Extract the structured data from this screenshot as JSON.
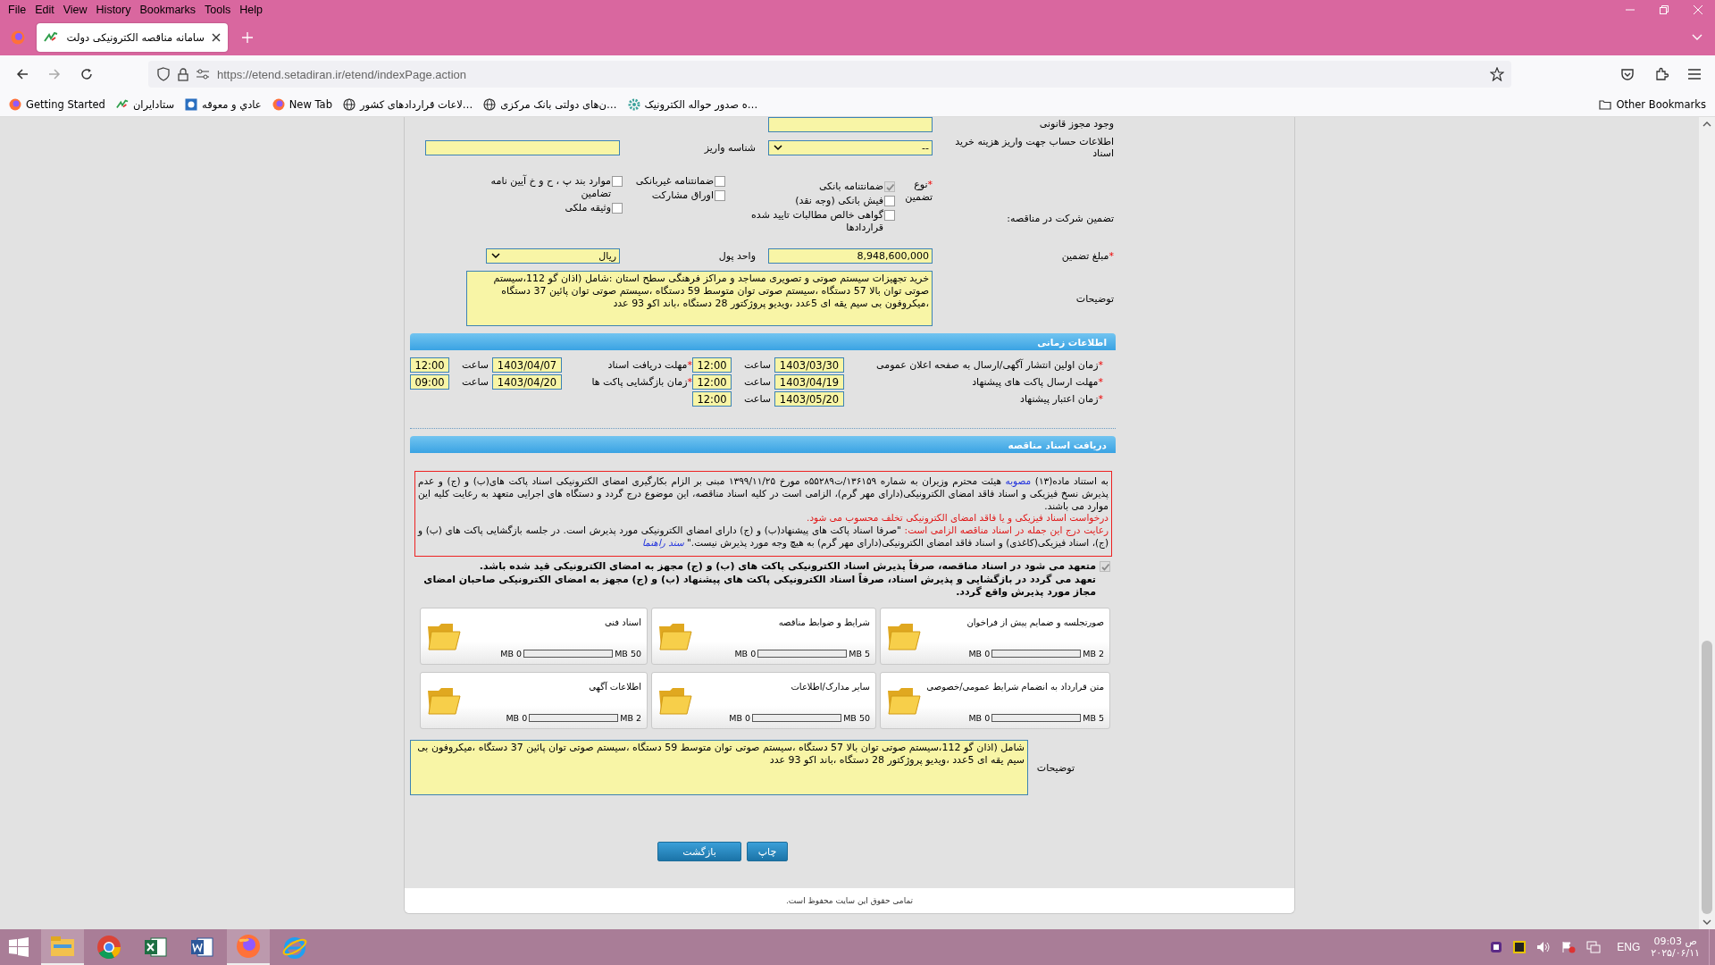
{
  "browser": {
    "menu": {
      "file": "File",
      "edit": "Edit",
      "view": "View",
      "history": "History",
      "bookmarks": "Bookmarks",
      "tools": "Tools",
      "help": "Help"
    },
    "tab": {
      "title": "سامانه مناقصه الکترونیکی دولت"
    },
    "url": {
      "host": "https://etend.setadiran.ir",
      "path": "/etend/indexPage.action"
    },
    "bookmarks": {
      "getting_started": {
        "label": "Getting Started",
        "kind": "firefox"
      },
      "setadiran": {
        "label": "ستادایران",
        "kind": "setad"
      },
      "overdue": {
        "label": "عادي و معوقه",
        "kind": "square"
      },
      "new_tab": {
        "label": "New Tab",
        "kind": "firefox"
      },
      "contracts": {
        "label": "…لاعات قراردادهای کشور",
        "kind": "globe"
      },
      "central_bank": {
        "label": "…ن‌های دولتی بانک مرکزی",
        "kind": "globe"
      },
      "remittance": {
        "label": "…ه صدور حواله الکترونیک",
        "kind": "gear"
      }
    },
    "other_bookmarks": "Other Bookmarks"
  },
  "form": {
    "cut_label": "وجود مجوز قانونی",
    "account": {
      "label": "اطلاعات حساب جهت واریز هزینه خرید اسناد",
      "value": "--"
    },
    "payment_id": {
      "label": "شناسه واریز"
    },
    "guarantee": {
      "label": "تضمین شرکت در مناقصه:",
      "type_label": "نوع تضمین",
      "mark": "*",
      "columns": [
        {
          "options": [
            {
              "label": "ضمانتنامه بانکی",
              "checked": true,
              "disabled": true
            },
            {
              "label": "فیش بانکی (وجه نقد)",
              "checked": false,
              "disabled": false
            },
            {
              "label": "گواهی خالص مطالبات تایید شده قراردادها",
              "checked": false,
              "disabled": false
            }
          ]
        },
        {
          "options": [
            {
              "label": "ضمانتنامه غیربانکی",
              "checked": false,
              "disabled": false
            },
            {
              "label": "اوراق مشارکت",
              "checked": false,
              "disabled": false
            }
          ]
        },
        {
          "options": [
            {
              "label": "موارد بند پ ، ح و خ آیین نامه تضامین",
              "checked": false,
              "disabled": false
            },
            {
              "label": "وثیقه ملکی",
              "checked": false,
              "disabled": false
            }
          ]
        }
      ]
    },
    "amount": {
      "label": "مبلغ تضمین",
      "mark": "*",
      "value": "8,948,600,000"
    },
    "currency": {
      "label": "واحد پول",
      "value": "ریال"
    },
    "description": {
      "label": "توضیحات",
      "value": "خرید تجهیزات سیستم صوتی و تصویری مساجد و مراکز فرهنگی سطح استان :شامل (اذان گو 112،سیستم صوتی توان بالا 57 دستگاه ،سیستم صوتی توان متوسط 59 دستگاه ،سیستم صوتی توان پائین 37 دستگاه ،میکروفون بی سیم یقه ای 5عدد ،ویدیو پروژکتور 28 دستگاه ،باند اکو 93 عدد"
    }
  },
  "time_section": {
    "title": "اطلاعات زمانی",
    "rows": [
      [
        {
          "label": "زمان اولین انتشار آگهی/ارسال به صفحه اعلان عمومی",
          "mark": "*",
          "date": "1403/03/30",
          "time_label": "ساعت",
          "time": "12:00"
        },
        {
          "label": "مهلت دریافت اسناد",
          "mark": "*",
          "date": "1403/04/07",
          "time_label": "ساعت",
          "time": "12:00"
        }
      ],
      [
        {
          "label": "مهلت ارسال پاکت های پیشنهاد",
          "mark": "*",
          "date": "1403/04/19",
          "time_label": "ساعت",
          "time": "12:00"
        },
        {
          "label": "زمان بازگشایی پاکت ها",
          "mark": "*",
          "date": "1403/04/20",
          "time_label": "ساعت",
          "time": "09:00"
        }
      ],
      [
        {
          "label": "زمان اعتبار پیشنهاد",
          "mark": "*",
          "date": "1403/05/20",
          "time_label": "ساعت",
          "time": "12:00"
        }
      ]
    ]
  },
  "documents_section": {
    "title": "دریافت اسناد مناقصه",
    "notice": [
      {
        "segments": [
          {
            "kind": "text",
            "text": "به استناد ماده(۱۳) "
          },
          {
            "kind": "link",
            "text": "مصوبه"
          },
          {
            "kind": "text",
            "text": " هیئت محترم وزیران به شماره ۱۳۶۱۵۹/ت۵۵۲۸۹ه مورخ ۱۳۹۹/۱۱/۲۵ مبنی بر الزام بکارگیری امضای الکترونیکی اسناد پاکت های(ب) و (ج) و عدم پذیرش نسخ فیزیکی و اسناد فاقد امضای الکترونیکی(دارای مهر گرم)، الزامی است در کلیه اسناد مناقصه، این موضوع درج گردد و دستگاه های اجرایی متعهد به رعایت کلیه این موارد می باشند."
          }
        ]
      },
      {
        "segments": [
          {
            "kind": "red",
            "text": "درخواست اسناد فیزیکی و یا فاقد امضای الکترونیکی تخلف محسوب می شود."
          }
        ]
      },
      {
        "segments": [
          {
            "kind": "red",
            "text": "رعایت درج این جمله در اسناد مناقصه الزامی است: "
          },
          {
            "kind": "text",
            "text": "\"صرفا اسناد پاکت های پیشنهاد(ب) و (ج) دارای امضای الکترونیکی مورد پذیرش است. در جلسه بازگشایی پاکت های (ب) و (ج)، اسناد فیزیکی(کاغذی) و اسناد فاقد امضای الکترونیکی(دارای مهر گرم) به هیچ وجه مورد پذیرش نیست.\" "
          },
          {
            "kind": "link",
            "text": "سند راهنما"
          }
        ]
      }
    ],
    "commitment": {
      "checked": true,
      "disabled": true,
      "lines": [
        "متعهد می شود در اسناد مناقصه، صرفاً پذیرش اسناد الکترونیکی پاکت های (ب) و (ج) مجهز به امضای الکترونیکی قید شده باشد.",
        "تعهد می گردد در بازگشایی و پذیرش اسناد، صرفاً اسناد الکترونیکی پاکت های پیشنهاد (ب) و (ج) مجهز به امضای الکترونیکی صاحبان امضای مجاز مورد پذیرش واقع گردد."
      ]
    },
    "files": [
      {
        "title": "صورتجلسه و ضمایم پیش از فراخوان",
        "used": "0 MB",
        "max": "2 MB",
        "level": 0
      },
      {
        "title": "شرایط و ضوابط مناقصه",
        "used": "0 MB",
        "max": "5 MB",
        "level": 0
      },
      {
        "title": "اسناد فنی",
        "used": "0 MB",
        "max": "50 MB",
        "level": 0
      },
      {
        "title": "متن قرارداد به انضمام شرایط عمومی/خصوصی",
        "used": "0 MB",
        "max": "5 MB",
        "level": 0
      },
      {
        "title": "سایر مدارک/اطلاعات",
        "used": "0 MB",
        "max": "50 MB",
        "level": 0
      },
      {
        "title": "اطلاعات آگهی",
        "used": "0 MB",
        "max": "2 MB",
        "level": 0
      }
    ],
    "description": {
      "label": "توضیحات",
      "value": "شامل (اذان گو 112،سیستم صوتی توان بالا 57 دستگاه ،سیستم صوتی توان متوسط 59 دستگاه ،سیستم صوتی توان پائین 37 دستگاه ،میکروفون بی سیم یقه ای 5عدد ،ویدیو پروژکتور 28 دستگاه ،باند اکو 93 عدد"
    }
  },
  "buttons": [
    {
      "label": "چاپ"
    },
    {
      "label": "بازگشت"
    }
  ],
  "footer": "تمامی حقوق این سایت محفوظ است.",
  "taskbar": {
    "apps": [
      {
        "kind": "explorer",
        "selected": true
      },
      {
        "kind": "chrome",
        "selected": false
      },
      {
        "kind": "excel",
        "selected": false
      },
      {
        "kind": "word",
        "selected": false
      },
      {
        "kind": "firefox",
        "selected": true
      },
      {
        "kind": "ie",
        "selected": false
      }
    ],
    "language": "ENG",
    "ampm": "ص",
    "time": "09:03",
    "date": "۲۰۲۵/۰۶/۱۱"
  }
}
